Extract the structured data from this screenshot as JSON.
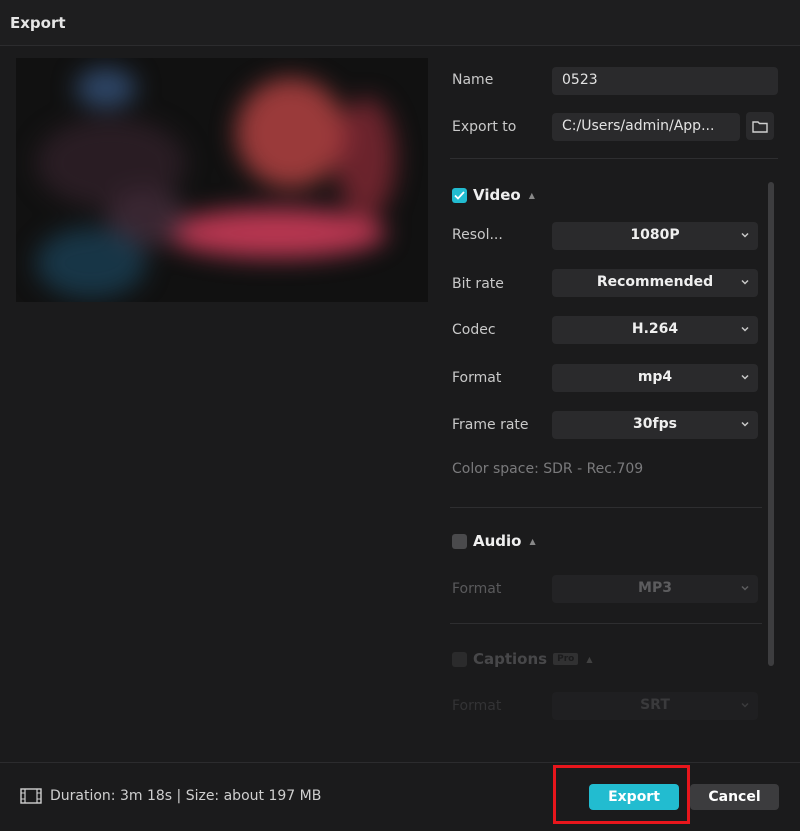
{
  "window": {
    "title": "Export"
  },
  "form": {
    "name_label": "Name",
    "name_value": "0523",
    "export_to_label": "Export to",
    "export_to_value": "C:/Users/admin/App..."
  },
  "video": {
    "title": "Video",
    "checked": true,
    "fields": [
      {
        "label": "Resol...",
        "value": "1080P"
      },
      {
        "label": "Bit rate",
        "value": "Recommended"
      },
      {
        "label": "Codec",
        "value": "H.264"
      },
      {
        "label": "Format",
        "value": "mp4"
      },
      {
        "label": "Frame rate",
        "value": "30fps"
      }
    ],
    "color_space": "Color space: SDR - Rec.709"
  },
  "audio": {
    "title": "Audio",
    "checked": false,
    "format_label": "Format",
    "format_value": "MP3"
  },
  "captions": {
    "title": "Captions",
    "badge": "Pro",
    "checked": false,
    "format_label": "Format",
    "format_value": "SRT"
  },
  "footer": {
    "info": "Duration: 3m 18s | Size: about 197 MB",
    "export_label": "Export",
    "cancel_label": "Cancel"
  },
  "colors": {
    "accent": "#22bcd0",
    "highlight": "#e8161c",
    "background": "#1b1b1c"
  },
  "icons": [
    "folder-icon",
    "checkmark-icon",
    "chevron-down-icon",
    "caret-up-icon",
    "film-icon"
  ]
}
